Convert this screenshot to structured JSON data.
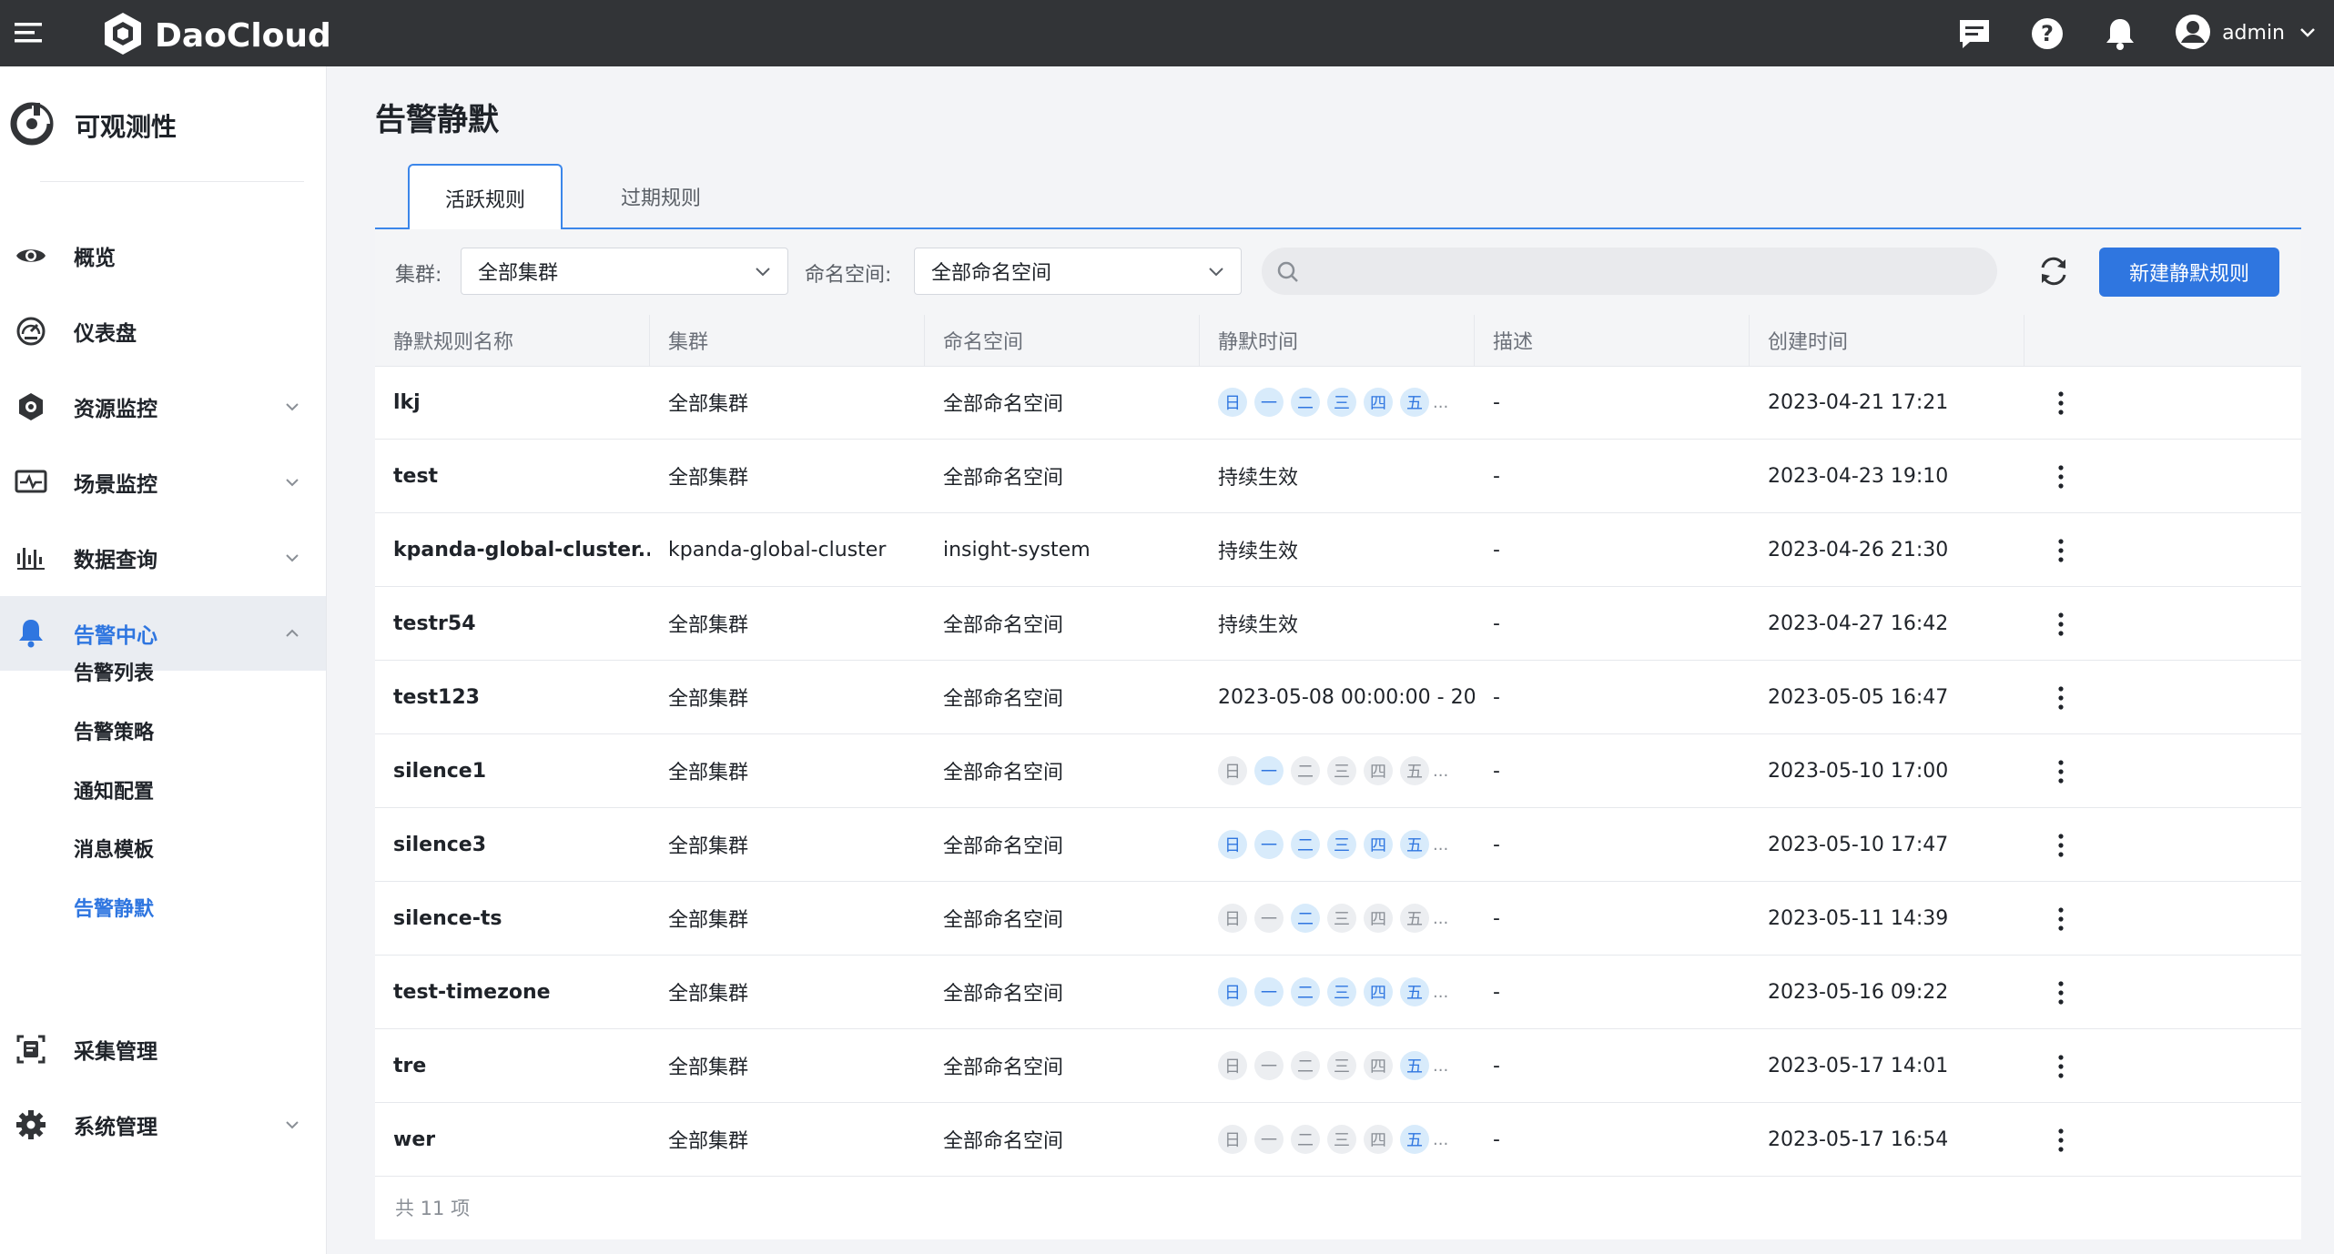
{
  "topbar": {
    "brand": "DaoCloud",
    "user": "admin",
    "icons": [
      "menu-icon",
      "chat-icon",
      "help-icon",
      "bell-icon",
      "user-avatar-icon",
      "chevron-down-icon"
    ]
  },
  "sidebar": {
    "product_title": "可观测性",
    "items": [
      {
        "label": "概览",
        "icon": "eye-icon"
      },
      {
        "label": "仪表盘",
        "icon": "gauge-icon"
      },
      {
        "label": "资源监控",
        "icon": "hexagon-icon"
      },
      {
        "label": "场景监控",
        "icon": "monitor-pulse-icon"
      },
      {
        "label": "数据查询",
        "icon": "waveform-icon"
      },
      {
        "label": "告警中心",
        "icon": "bell-icon"
      },
      {
        "label": "采集管理",
        "icon": "collect-icon"
      },
      {
        "label": "系统管理",
        "icon": "gear-icon"
      }
    ],
    "sub_items": [
      "告警列表",
      "告警策略",
      "通知配置",
      "消息模板",
      "告警静默"
    ]
  },
  "page": {
    "title": "告警静默",
    "tabs": [
      "活跃规则",
      "过期规则"
    ]
  },
  "filters": {
    "cluster_label": "集群:",
    "cluster_value": "全部集群",
    "namespace_label": "命名空间:",
    "namespace_value": "全部命名空间",
    "search_placeholder": "",
    "new_button": "新建静默规则"
  },
  "table": {
    "columns": [
      "静默规则名称",
      "集群",
      "命名空间",
      "静默时间",
      "描述",
      "创建时间"
    ],
    "day_labels": [
      "日",
      "一",
      "二",
      "三",
      "四",
      "五"
    ],
    "rows": [
      {
        "name": "lkj",
        "cluster": "全部集群",
        "namespace": "全部命名空间",
        "time": "",
        "days": [
          1,
          1,
          1,
          1,
          1,
          1
        ],
        "desc": "-",
        "created": "2023-04-21 17:21"
      },
      {
        "name": "test",
        "cluster": "全部集群",
        "namespace": "全部命名空间",
        "time": "持续生效",
        "days": null,
        "desc": "-",
        "created": "2023-04-23 19:10"
      },
      {
        "name": "kpanda-global-cluster...",
        "cluster": "kpanda-global-cluster",
        "namespace": "insight-system",
        "time": "持续生效",
        "days": null,
        "desc": "-",
        "created": "2023-04-26 21:30"
      },
      {
        "name": "testr54",
        "cluster": "全部集群",
        "namespace": "全部命名空间",
        "time": "持续生效",
        "days": null,
        "desc": "-",
        "created": "2023-04-27 16:42"
      },
      {
        "name": "test123",
        "cluster": "全部集群",
        "namespace": "全部命名空间",
        "time": "2023-05-08 00:00:00 - 20",
        "days": null,
        "desc": "-",
        "created": "2023-05-05 16:47"
      },
      {
        "name": "silence1",
        "cluster": "全部集群",
        "namespace": "全部命名空间",
        "time": "",
        "days": [
          0,
          1,
          0,
          0,
          0,
          0
        ],
        "desc": "-",
        "created": "2023-05-10 17:00"
      },
      {
        "name": "silence3",
        "cluster": "全部集群",
        "namespace": "全部命名空间",
        "time": "",
        "days": [
          1,
          1,
          1,
          1,
          1,
          1
        ],
        "desc": "-",
        "created": "2023-05-10 17:47"
      },
      {
        "name": "silence-ts",
        "cluster": "全部集群",
        "namespace": "全部命名空间",
        "time": "",
        "days": [
          0,
          0,
          1,
          0,
          0,
          0
        ],
        "desc": "-",
        "created": "2023-05-11 14:39"
      },
      {
        "name": "test-timezone",
        "cluster": "全部集群",
        "namespace": "全部命名空间",
        "time": "",
        "days": [
          1,
          1,
          1,
          1,
          1,
          1
        ],
        "desc": "-",
        "created": "2023-05-16 09:22"
      },
      {
        "name": "tre",
        "cluster": "全部集群",
        "namespace": "全部命名空间",
        "time": "",
        "days": [
          0,
          0,
          0,
          0,
          0,
          1
        ],
        "desc": "-",
        "created": "2023-05-17 14:01"
      },
      {
        "name": "wer",
        "cluster": "全部集群",
        "namespace": "全部命名空间",
        "time": "",
        "days": [
          0,
          0,
          0,
          0,
          0,
          1
        ],
        "desc": "-",
        "created": "2023-05-17 16:54"
      }
    ],
    "ellipsis": "...",
    "total": "共 11 项"
  },
  "colors": {
    "accent": "#2f76e0",
    "topbar": "#323437",
    "day_on_bg": "#d8ebfb",
    "day_off_bg": "#eceef1"
  }
}
